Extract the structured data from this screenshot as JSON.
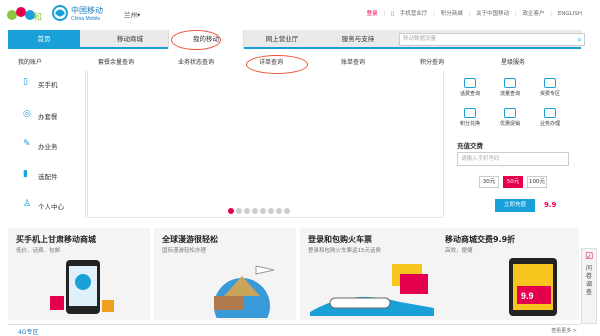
{
  "brand": {
    "and_text": "and和",
    "cm_cn": "中国移动",
    "cm_en": "China Mobile",
    "city": "兰州▾",
    "colors": {
      "accent": "#1aa0d9",
      "brand_pink": "#e5004f",
      "and_green": "#8cc63f"
    }
  },
  "toplinks": {
    "login": "登录",
    "hall": "手机营业厅",
    "points_mall": "积分商城",
    "about": "关于中国移动",
    "group": "政企客户",
    "english": "ENGLISH"
  },
  "nav": {
    "tabs": [
      "首页",
      "移动商城",
      "我的移动",
      "网上营业厅",
      "服务与支持"
    ],
    "search_placeholder": "移动数据流量"
  },
  "subnav": [
    "我的账户",
    "套餐余量查询",
    "业务状态查询",
    "详单查询",
    "账单查询",
    "积分查询",
    "星级服务"
  ],
  "sidebar": [
    {
      "label": "买手机",
      "icon": "phone-icon"
    },
    {
      "label": "办套餐",
      "icon": "package-icon"
    },
    {
      "label": "办业务",
      "icon": "service-icon"
    },
    {
      "label": "选配件",
      "icon": "accessory-icon"
    },
    {
      "label": "个人中心",
      "icon": "user-icon"
    }
  ],
  "services": [
    {
      "label": "话费查询"
    },
    {
      "label": "流量查询"
    },
    {
      "label": "资费专区"
    },
    {
      "label": "积分兑换"
    },
    {
      "label": "优惠促销"
    },
    {
      "label": "业务办理"
    }
  ],
  "recharge": {
    "title": "充值交费",
    "placeholder": "请输入手机号码",
    "amounts": [
      "30元",
      "50元",
      "100元"
    ],
    "button": "立即充值",
    "price": "9.9"
  },
  "promos": [
    {
      "title": "买手机上甘肃移动商城",
      "subtitle": "低价、话费、包邮"
    },
    {
      "title": "全球漫游很轻松",
      "subtitle": "国际漫游轻松办理"
    },
    {
      "title": "登录和包购火车票",
      "subtitle": "登录和包购火车票返15元话费"
    },
    {
      "title": "移动商城交费9.9折",
      "subtitle": "高效，便捷"
    }
  ],
  "float_panel": {
    "text": "问卷调查"
  },
  "g4": {
    "title": "4G专区",
    "more": "查看更多 >"
  }
}
